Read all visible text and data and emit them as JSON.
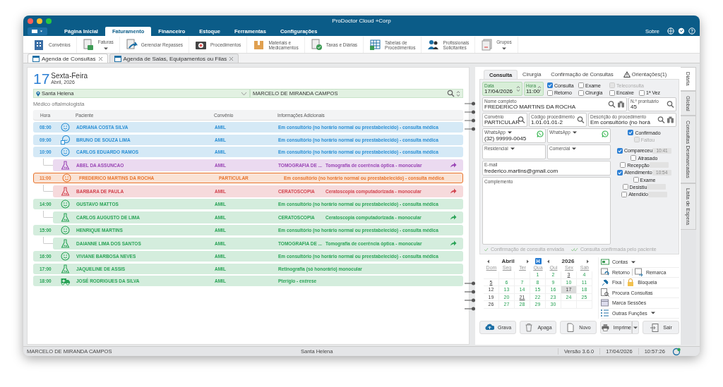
{
  "window": {
    "title": "ProDoctor Cloud +Corp"
  },
  "menu_tabs": [
    {
      "label": "Página Inicial",
      "selected": false
    },
    {
      "label": "Faturamento",
      "selected": true
    },
    {
      "label": "Financeiro",
      "selected": false
    },
    {
      "label": "Estoque",
      "selected": false
    },
    {
      "label": "Ferramentas",
      "selected": false
    },
    {
      "label": "Configurações",
      "selected": false
    }
  ],
  "about": "Sobre",
  "ribbon": [
    {
      "label": "Convênios",
      "dropdown": false
    },
    {
      "label": "Faturas",
      "dropdown": true
    },
    {
      "label": "Gerenciar Repasses",
      "dropdown": false
    },
    {
      "label": "Procedimentos",
      "dropdown": false
    },
    {
      "label": "Materiais e\nMedicamentos",
      "dropdown": false
    },
    {
      "label": "Taxas e Diárias",
      "dropdown": false
    },
    {
      "label": "Tabelas de\nProcedimentos",
      "dropdown": false
    },
    {
      "label": "Profissionais\nSolicitantes",
      "dropdown": false
    },
    {
      "label": "Grupos",
      "dropdown": true
    }
  ],
  "doc_tabs": [
    {
      "label": "Agenda de Consultas",
      "selected": true
    },
    {
      "label": "Agenda de Salas, Equipamentos ou Filas",
      "selected": false
    }
  ],
  "agenda": {
    "day": "17",
    "weekday": "Sexta-Feira",
    "month_year": "Abril, 2026",
    "location": "Santa Helena",
    "doctor": "MARCELO DE MIRANDA CAMPOS",
    "specialty": "Médico oftalmologista",
    "columns": [
      "Hora",
      "Paciente",
      "Convênio",
      "Informações Adicionais"
    ],
    "appointments": [
      {
        "time": "08:00",
        "kind": "consult",
        "patient": "ADRIANA COSTA SILVA",
        "insurance": "AMIL",
        "info": "Em consultório (no horário normal ou preestabelecido) - consulta médica",
        "color": "#2b8fd4",
        "selected": false
      },
      {
        "time": "09:00",
        "kind": "chat",
        "patient": "BRUNO DE SOUZA LIMA",
        "insurance": "AMIL",
        "info": "Em consultório (no horário normal ou preestabelecido) - consulta médica",
        "color": "#2b8fd4",
        "selected": false
      },
      {
        "time": "10:00",
        "kind": "consult",
        "patient": "CARLOS EDUARDO RAMOS",
        "insurance": "AMIL",
        "info": "Em consultório (no horário normal ou preestabelecido) - consulta médica",
        "color": "#2b8fd4",
        "selected": false,
        "children": [
          {
            "kind": "exam",
            "patient": "ABEL DA ASSUNCAO",
            "insurance": "AMIL",
            "procedure": "TOMOGRAFIA DE ...",
            "info": "Tomografia de coerência óptica - monocular",
            "color": "#9a45b5",
            "selected": false
          }
        ]
      },
      {
        "time": "11:00",
        "kind": "consult",
        "patient": "FREDERICO MARTINS DA ROCHA",
        "insurance": "PARTICULAR",
        "info": "Em consultório (no horário normal ou preestabelecido) - consulta médica",
        "color": "#e8742c",
        "selected": true,
        "children": [
          {
            "kind": "exam",
            "patient": "BARBARA DE PAULA",
            "insurance": "AMIL",
            "procedure": "CERATOSCOPIA",
            "info": "Ceratoscopia computadorizada - monocular",
            "color": "#d2454f",
            "selected": false
          }
        ]
      },
      {
        "time": "14:00",
        "kind": "consult",
        "patient": "GUSTAVO MATTOS",
        "insurance": "AMIL",
        "info": "Em consultório (no horário normal ou preestabelecido) - consulta médica",
        "color": "#2aa357",
        "selected": false,
        "children": [
          {
            "kind": "exam",
            "patient": "CARLOS AUGUSTO DE LIMA",
            "insurance": "AMIL",
            "procedure": "CERATOSCOPIA",
            "info": "Ceratoscopia computadorizada - monocular",
            "color": "#2aa357",
            "selected": false
          }
        ]
      },
      {
        "time": "15:00",
        "kind": "consult",
        "patient": "HENRIQUE MARTINS",
        "insurance": "AMIL",
        "info": "Em consultório (no horário normal ou preestabelecido) - consulta médica",
        "color": "#2aa357",
        "selected": false,
        "children": [
          {
            "kind": "exam",
            "patient": "DAIANNE LIMA DOS SANTOS",
            "insurance": "AMIL",
            "procedure": "TOMOGRAFIA DE ...",
            "info": "Tomografia de coerência óptica - monocular",
            "color": "#2aa357",
            "selected": false
          }
        ]
      },
      {
        "time": "16:00",
        "kind": "consult",
        "patient": "VIVIANE BARBOSA NEVES",
        "insurance": "AMIL",
        "info": "Em consultório (no horário normal ou preestabelecido) - consulta médica",
        "color": "#2aa357",
        "selected": false
      },
      {
        "time": "17:00",
        "kind": "exam",
        "patient": "JAQUELINE DE ASSIS",
        "insurance": "AMIL",
        "info": "Retinografia (só honorário) monocular",
        "color": "#2aa357",
        "selected": false
      },
      {
        "time": "18:00",
        "kind": "vehicle",
        "patient": "JOSÉ RODRIGUES DA SILVA",
        "insurance": "AMIL",
        "info": "Pterígio - exérese",
        "color": "#2aa357",
        "selected": false
      }
    ]
  },
  "form": {
    "tabs": [
      {
        "label": "Consulta",
        "selected": true,
        "warning": false
      },
      {
        "label": "Cirurgia",
        "selected": false,
        "warning": false
      },
      {
        "label": "Confirmação de Consultas",
        "selected": false,
        "warning": false
      },
      {
        "label": "Orientações(1)",
        "selected": false,
        "warning": true
      }
    ],
    "date": {
      "label": "Data",
      "value": "17/04/2026"
    },
    "hour": {
      "label": "Hora",
      "value": "11:00"
    },
    "types": [
      {
        "label": "Consulta",
        "checked": true,
        "disabled": false
      },
      {
        "label": "Exame",
        "checked": false,
        "disabled": false
      },
      {
        "label": "Teleconsulta",
        "checked": false,
        "disabled": true
      },
      {
        "label": "Retorno",
        "checked": false,
        "disabled": false
      },
      {
        "label": "Cirurgia",
        "checked": false,
        "disabled": false
      },
      {
        "label": "Encaixe",
        "checked": false,
        "disabled": false
      },
      {
        "label": "1ª Vez",
        "checked": false,
        "disabled": false
      }
    ],
    "name": {
      "label": "Nome completo",
      "value": "FREDERICO MARTINS DA ROCHA"
    },
    "record": {
      "label": "N.º prontuário",
      "value": "45"
    },
    "insurance": {
      "label": "Convênio",
      "value": "PARTICULAR"
    },
    "code": {
      "label": "Código procedimento",
      "value": "1.01.01.01-2"
    },
    "description": {
      "label": "Descrição do procedimento",
      "value": "Em consultório (no horá"
    },
    "phones": [
      {
        "label": "WhatsApp",
        "value": "(32) 99999-0045",
        "whatsapp": true
      },
      {
        "label": "WhatsApp",
        "whatsapp": true
      },
      {
        "label": "Residencial",
        "whatsapp": false
      },
      {
        "label": "Comercial",
        "whatsapp": false
      }
    ],
    "email": {
      "label": "E-mail",
      "value": "frederico.martins@gmail.com"
    },
    "complement": {
      "label": "Complemento"
    },
    "confirmation": [
      {
        "label": "Confirmado",
        "checked": true,
        "disabled": false
      },
      {
        "label": "Faltou",
        "checked": false,
        "disabled": true
      }
    ],
    "progress": [
      {
        "label": "Compareceu",
        "checked": true,
        "time_box": true,
        "time": "10:41"
      },
      {
        "label": "Atrasado",
        "checked": false,
        "time_box": false
      },
      {
        "label": "Recepção",
        "checked": false,
        "time_box": true
      },
      {
        "label": "Atendimento",
        "checked": true,
        "time_box": true,
        "time": "10:54"
      },
      {
        "label": "Exame",
        "checked": false,
        "time_box": false
      },
      {
        "label": "Desistiu",
        "checked": false,
        "time_box": true
      },
      {
        "label": "Atendido",
        "checked": false,
        "time_box": true
      }
    ],
    "notes": [
      "Confirmação de consulta enviada",
      "Consulta confirmada pelo paciente"
    ]
  },
  "calendar": {
    "month": "Abril",
    "year": "2026",
    "today": "H",
    "weekdays": [
      "Dom",
      "Seg",
      "Ter",
      "Qua",
      "Qui",
      "Sex",
      "Sáb"
    ],
    "weeks": [
      [
        {
          "empty": true
        },
        {
          "empty": true
        },
        {
          "empty": true
        },
        {
          "day": "1",
          "available": true,
          "holiday": false,
          "selected": false
        },
        {
          "day": "2",
          "available": true,
          "holiday": false,
          "selected": false
        },
        {
          "day": "3",
          "available": false,
          "holiday": true,
          "selected": false
        },
        {
          "day": "4",
          "available": true,
          "holiday": false,
          "selected": false
        }
      ],
      [
        {
          "day": "5",
          "available": false,
          "holiday": true,
          "selected": false
        },
        {
          "day": "6",
          "available": true,
          "holiday": false,
          "selected": false
        },
        {
          "day": "7",
          "available": true,
          "holiday": false,
          "selected": false
        },
        {
          "day": "8",
          "available": true,
          "holiday": false,
          "selected": false
        },
        {
          "day": "9",
          "available": true,
          "holiday": false,
          "selected": false
        },
        {
          "day": "10",
          "available": true,
          "holiday": false,
          "selected": false
        },
        {
          "day": "11",
          "available": true,
          "holiday": false,
          "selected": false
        }
      ],
      [
        {
          "day": "12",
          "available": false,
          "holiday": false,
          "selected": false
        },
        {
          "day": "13",
          "available": true,
          "holiday": false,
          "selected": false
        },
        {
          "day": "14",
          "available": true,
          "holiday": false,
          "selected": false
        },
        {
          "day": "15",
          "available": true,
          "holiday": false,
          "selected": false
        },
        {
          "day": "16",
          "available": true,
          "holiday": false,
          "selected": false
        },
        {
          "day": "17",
          "available": false,
          "holiday": false,
          "selected": true
        },
        {
          "day": "18",
          "available": true,
          "holiday": false,
          "selected": false
        }
      ],
      [
        {
          "day": "19",
          "available": false,
          "holiday": false,
          "selected": false
        },
        {
          "day": "20",
          "available": true,
          "holiday": false,
          "selected": false
        },
        {
          "day": "21",
          "available": false,
          "holiday": true,
          "selected": false
        },
        {
          "day": "22",
          "available": true,
          "holiday": false,
          "selected": false
        },
        {
          "day": "23",
          "available": true,
          "holiday": false,
          "selected": false
        },
        {
          "day": "24",
          "available": true,
          "holiday": false,
          "selected": false
        },
        {
          "day": "25",
          "available": true,
          "holiday": false,
          "selected": false
        }
      ],
      [
        {
          "day": "26",
          "available": false,
          "holiday": false,
          "selected": false
        },
        {
          "day": "27",
          "available": true,
          "holiday": false,
          "selected": false
        },
        {
          "day": "28",
          "available": true,
          "holiday": false,
          "selected": false
        },
        {
          "day": "29",
          "available": true,
          "holiday": false,
          "selected": false
        },
        {
          "day": "30",
          "available": true,
          "holiday": false,
          "selected": false
        },
        {
          "empty": true
        },
        {
          "empty": true
        }
      ]
    ]
  },
  "actions": [
    [
      {
        "label": "Contas",
        "dropdown": true
      }
    ],
    [
      {
        "label": "Retorno",
        "dropdown": false
      },
      {
        "label": "Remarca",
        "dropdown": false
      }
    ],
    [
      {
        "label": "Fixa",
        "dropdown": false
      },
      {
        "label": "Bloqueia",
        "dropdown": false
      }
    ],
    [
      {
        "label": "Procura Consultas",
        "dropdown": false
      }
    ],
    [
      {
        "label": "Marca Sessões",
        "dropdown": false
      }
    ],
    [
      {
        "label": "Outras Funções",
        "dropdown": true
      }
    ]
  ],
  "buttons": [
    {
      "label": "Grava",
      "dropdown": false
    },
    {
      "label": "Apaga",
      "dropdown": false
    },
    {
      "label": "Novo",
      "dropdown": false
    },
    {
      "label": "Imprime",
      "dropdown": true
    },
    {
      "label": "Sair",
      "dropdown": false
    }
  ],
  "side_tabs": [
    {
      "label": "Diária",
      "selected": true
    },
    {
      "label": "Global",
      "selected": false
    },
    {
      "label": "Consultas Desmarcadas",
      "selected": false
    },
    {
      "label": "Lista de Espera",
      "selected": false
    }
  ],
  "status_bar": {
    "user": "MARCELO DE MIRANDA CAMPOS",
    "location": "Santa Helena",
    "version": "Versão 3.6.0",
    "date": "17/04/2026",
    "time": "10:57:26"
  }
}
